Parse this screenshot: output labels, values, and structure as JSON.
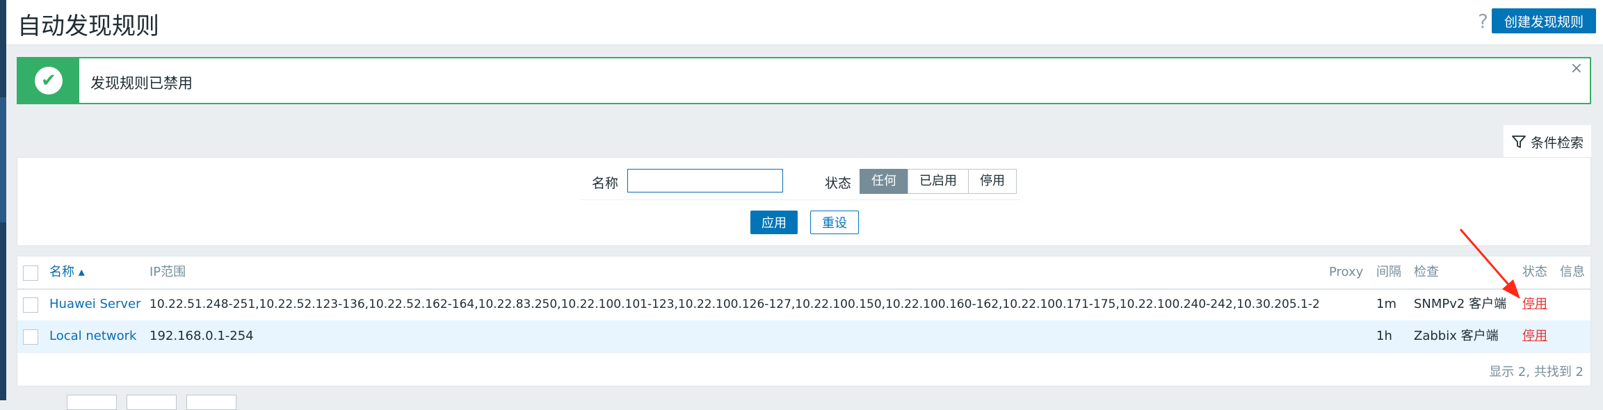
{
  "header": {
    "title": "自动发现规则",
    "help_icon": "?",
    "create_label": "创建发现规则"
  },
  "message": {
    "text": "发现规则已禁用",
    "close": "×"
  },
  "filter": {
    "tab_label": "条件检索",
    "name_label": "名称",
    "name_value": "",
    "status_label": "状态",
    "status_options": [
      "任何",
      "已启用",
      "停用"
    ],
    "status_selected": "任何",
    "apply_label": "应用",
    "reset_label": "重设"
  },
  "table": {
    "columns": {
      "name": "名称 ▴",
      "ip": "IP范围",
      "proxy": "Proxy",
      "interval": "间隔",
      "checks": "检查",
      "status": "状态",
      "info": "信息"
    },
    "rows": [
      {
        "name": "Huawei Server",
        "ip": "10.22.51.248-251,10.22.52.123-136,10.22.52.162-164,10.22.83.250,10.22.100.101-123,10.22.100.126-127,10.22.100.150,10.22.100.160-162,10.22.100.171-175,10.22.100.240-242,10.30.205.1-2",
        "proxy": "",
        "interval": "1m",
        "checks": "SNMPv2 客户端",
        "status": "停用"
      },
      {
        "name": "Local network",
        "ip": "192.168.0.1-254",
        "proxy": "",
        "interval": "1h",
        "checks": "Zabbix 客户端",
        "status": "停用"
      }
    ],
    "footer": "显示 2, 共找到 2"
  },
  "colors": {
    "accent": "#0275b8",
    "success": "#34af67",
    "disabled": "#e33734",
    "annotation": "#ff2a1a"
  }
}
